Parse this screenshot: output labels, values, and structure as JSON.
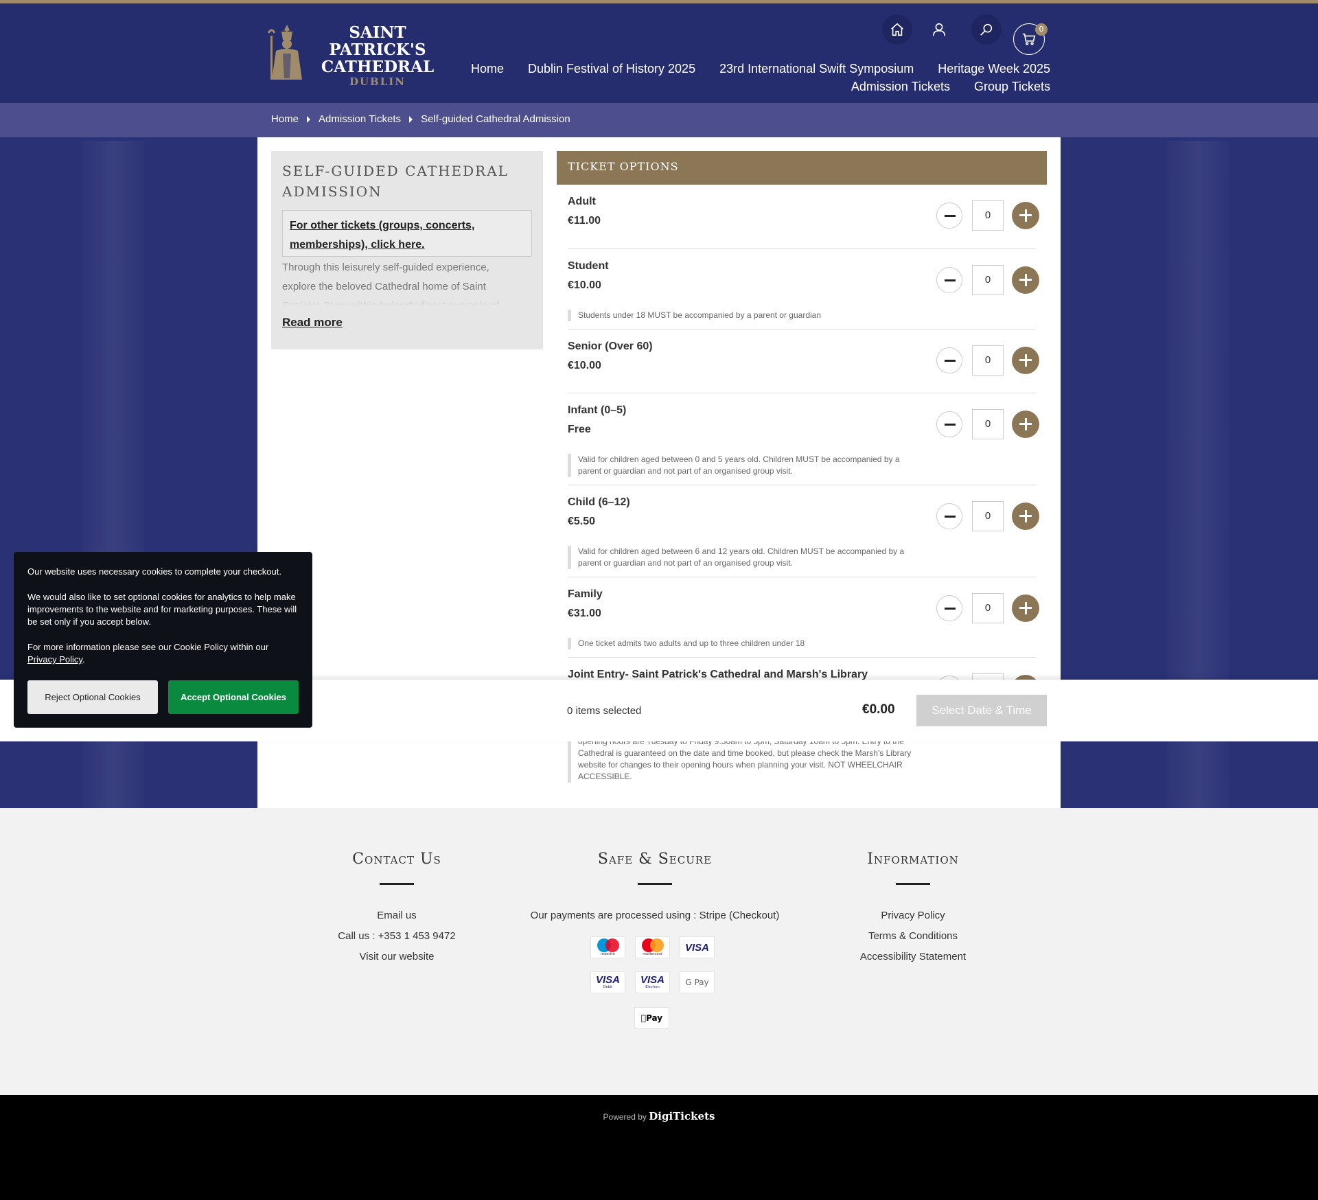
{
  "brand": {
    "name_line1": "SAINT",
    "name_line2": "PATRICK'S",
    "name_line3": "CATHEDRAL",
    "name_line4": "DUBLIN",
    "accent": "#8b7755",
    "navy": "#262d6e"
  },
  "header": {
    "cart_count": "0",
    "icons": [
      "home-icon",
      "user-icon",
      "search-icon",
      "cart-icon"
    ],
    "nav_row1": [
      "Home",
      "Dublin Festival of History 2025",
      "23rd International Swift Symposium",
      "Heritage Week 2025"
    ],
    "nav_row2": [
      "Admission Tickets",
      "Group Tickets"
    ]
  },
  "breadcrumb": [
    "Home",
    "Admission Tickets",
    "Self-guided Cathedral Admission"
  ],
  "product": {
    "title": "SELF-GUIDED CATHEDRAL ADMISSION",
    "other_tickets_link": "For other tickets (groups, concerts, memberships), click here.",
    "description": "Through this leisurely self-guided experience, explore the beloved Cathedral home of Saint Patrick's Story within Ireland's finest example of",
    "read_more": "Read more"
  },
  "tickets": {
    "heading": "TICKET OPTIONS",
    "items": [
      {
        "name": "Adult",
        "price": "€11.00",
        "qty": "0",
        "note": ""
      },
      {
        "name": "Student",
        "price": "€10.00",
        "qty": "0",
        "note": "Students under 18 MUST be accompanied by a parent or guardian"
      },
      {
        "name": "Senior (Over 60)",
        "price": "€10.00",
        "qty": "0",
        "note": ""
      },
      {
        "name": "Infant (0–5)",
        "price": "Free",
        "qty": "0",
        "note": "Valid for children aged between 0 and 5 years old. Children MUST be accompanied by a parent or guardian and not part of an organised group visit."
      },
      {
        "name": "Child (6–12)",
        "price": "€5.50",
        "qty": "0",
        "note": "Valid for children aged between 6 and 12 years old. Children MUST be accompanied by a parent or guardian and not part of an organised group visit."
      },
      {
        "name": "Family",
        "price": "€31.00",
        "qty": "0",
        "note": "One ticket admits two adults and up to three children under 18"
      },
      {
        "name": "Joint Entry- Saint Patrick's Cathedral and Marsh's Library",
        "price": "",
        "qty": "",
        "note": ""
      }
    ],
    "trailing_note": "opening hours are Tuesday to Friday 9.30am to 5pm, Saturday 10am to 5pm. Entry to the Cathedral is guaranteed on the date and time booked, but please check the Marsh's Library website for changes to their opening hours when planning your visit. NOT WHEELCHAIR ACCESSIBLE."
  },
  "basket": {
    "items_selected": "0 items selected",
    "total": "€0.00",
    "cta": "Select Date & Time"
  },
  "cookie_banner": {
    "p1": "Our website uses necessary cookies to complete your checkout.",
    "p2": "We would also like to set optional cookies for analytics to help make improvements to the website and for marketing purposes. These will be set only if you accept below.",
    "p3": "For more information please see our Cookie Policy within our",
    "p3_link": "Privacy Policy",
    "p3_end": ".",
    "reject": "Reject Optional Cookies",
    "accept": "Accept Optional Cookies"
  },
  "footer": {
    "contact": {
      "title": "Contact Us",
      "links": [
        "Email us",
        "Call us : +353 1 453 9472",
        "Visit our website"
      ]
    },
    "secure": {
      "title": "Safe & Secure",
      "text": "Our payments are processed using : Stripe (Checkout)",
      "maestro_label": "maestro",
      "mastercard_label": "mastercard",
      "visa": "VISA",
      "visa_debit_label": "Debit",
      "visa_electron_label": "Electron",
      "gpay": "G Pay",
      "applepay": "Pay"
    },
    "info": {
      "title": "Information",
      "links": [
        "Privacy Policy",
        "Terms & Conditions",
        "Accessibility Statement"
      ]
    }
  },
  "powered": {
    "prefix": "Powered by",
    "brand": "DigiTickets"
  }
}
